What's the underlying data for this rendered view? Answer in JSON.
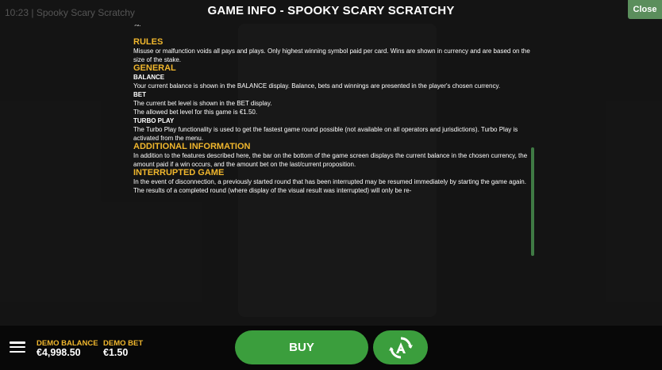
{
  "status_bar": {
    "time": "10:23",
    "separator": "|",
    "app_name": "Spooky Scary Scratchy"
  },
  "header": {
    "title": "GAME INFO - SPOOKY SCARY SCRATCHY",
    "close_label": "Close"
  },
  "info": {
    "lead_text": "%.",
    "rules": {
      "heading": "RULES",
      "text": "Misuse or malfunction voids all pays and plays. Only highest winning symbol paid per card. Wins are shown in currency and are based on the size of the stake."
    },
    "general": {
      "heading": "GENERAL",
      "balance_heading": "BALANCE",
      "balance_text": "Your current balance is shown in the BALANCE display. Balance, bets and winnings are presented in the player's chosen currency.",
      "bet_heading": "BET",
      "bet_text1": "The current bet level is shown in the BET display.",
      "bet_text2": "The allowed bet level for this game is €1.50.",
      "turbo_heading": "TURBO PLAY",
      "turbo_text": "The Turbo Play functionality is used to get the fastest game round possible (not available on all operators and jurisdictions). Turbo Play is activated from the menu."
    },
    "additional": {
      "heading": "ADDITIONAL INFORMATION",
      "text": "In addition to the features described here, the bar on the bottom of the game screen displays the current balance in the chosen currency, the amount paid if a win occurs, and the amount bet on the last/current proposition."
    },
    "interrupted": {
      "heading": "INTERRUPTED GAME",
      "text": "In the event of disconnection, a previously started round that has been interrupted may be resumed immediately by starting the game again. The results of a completed round (where display of the visual result was interrupted) will only be re-"
    }
  },
  "footer": {
    "balance_label": "DEMO BALANCE",
    "balance_value": "€4,998.50",
    "bet_label": "DEMO BET",
    "bet_value": "€1.50",
    "buy_label": "BUY",
    "autoplay_icon": "autoplay-icon"
  },
  "colors": {
    "accent_gold": "#f1b72d",
    "button_green": "#3b9e3d",
    "close_green": "#5b8e5c",
    "scrollbar_green": "#3f7a44"
  }
}
